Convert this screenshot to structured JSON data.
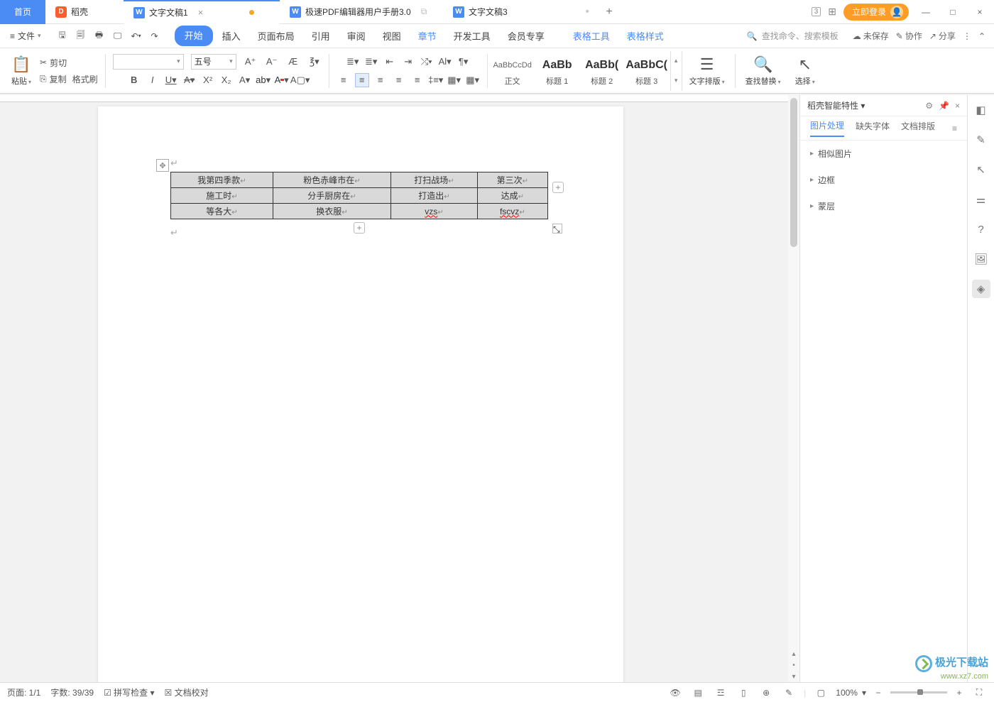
{
  "titleBar": {
    "homeTab": "首页",
    "dockeTab": "稻壳",
    "tabs": [
      {
        "label": "文字文稿1",
        "modified": true
      },
      {
        "label": "极速PDF编辑器用户手册3.0"
      },
      {
        "label": "文字文稿3"
      }
    ],
    "badge3": "3",
    "login": "立即登录"
  },
  "menu": {
    "file": "文件",
    "tabs": [
      "开始",
      "插入",
      "页面布局",
      "引用",
      "审阅",
      "视图",
      "章节",
      "开发工具",
      "会员专享"
    ],
    "tableTools": "表格工具",
    "tableStyle": "表格样式",
    "searchPlaceholder": "查找命令、搜索模板",
    "unsaved": "未保存",
    "coop": "协作",
    "share": "分享"
  },
  "ribbon": {
    "paste": "粘贴",
    "cut": "剪切",
    "copy": "复制",
    "formatPainter": "格式刷",
    "fontSize": "五号",
    "normal": "正文",
    "heading1": "标题 1",
    "heading2": "标题 2",
    "heading3": "标题 3",
    "stylePreview": "AaBbCcDd",
    "stylePreviewBold": "AaBb",
    "stylePreviewB3": "AaBb(",
    "stylePreviewB4": "AaBbC(",
    "textLayout": "文字排版",
    "findReplace": "查找替换",
    "select": "选择"
  },
  "table": {
    "rows": [
      [
        "我第四季款",
        "粉色赤峰市在",
        "打扫战场",
        "第三次"
      ],
      [
        "施工时",
        "分手厨房在",
        "打造出",
        "达成"
      ],
      [
        "等各大",
        "换衣服",
        "vzs",
        "fscvz"
      ]
    ]
  },
  "panel": {
    "title": "稻壳智能特性",
    "tabs": [
      "图片处理",
      "缺失字体",
      "文档排版"
    ],
    "sections": [
      "相似图片",
      "边框",
      "蒙层"
    ]
  },
  "status": {
    "page": "页面: 1/1",
    "words": "字数: 39/39",
    "spellcheck": "拼写检查",
    "docCheck": "文档校对",
    "zoom": "100%"
  },
  "watermark": {
    "l1": "极光下载站",
    "l2": "www.xz7.com"
  }
}
